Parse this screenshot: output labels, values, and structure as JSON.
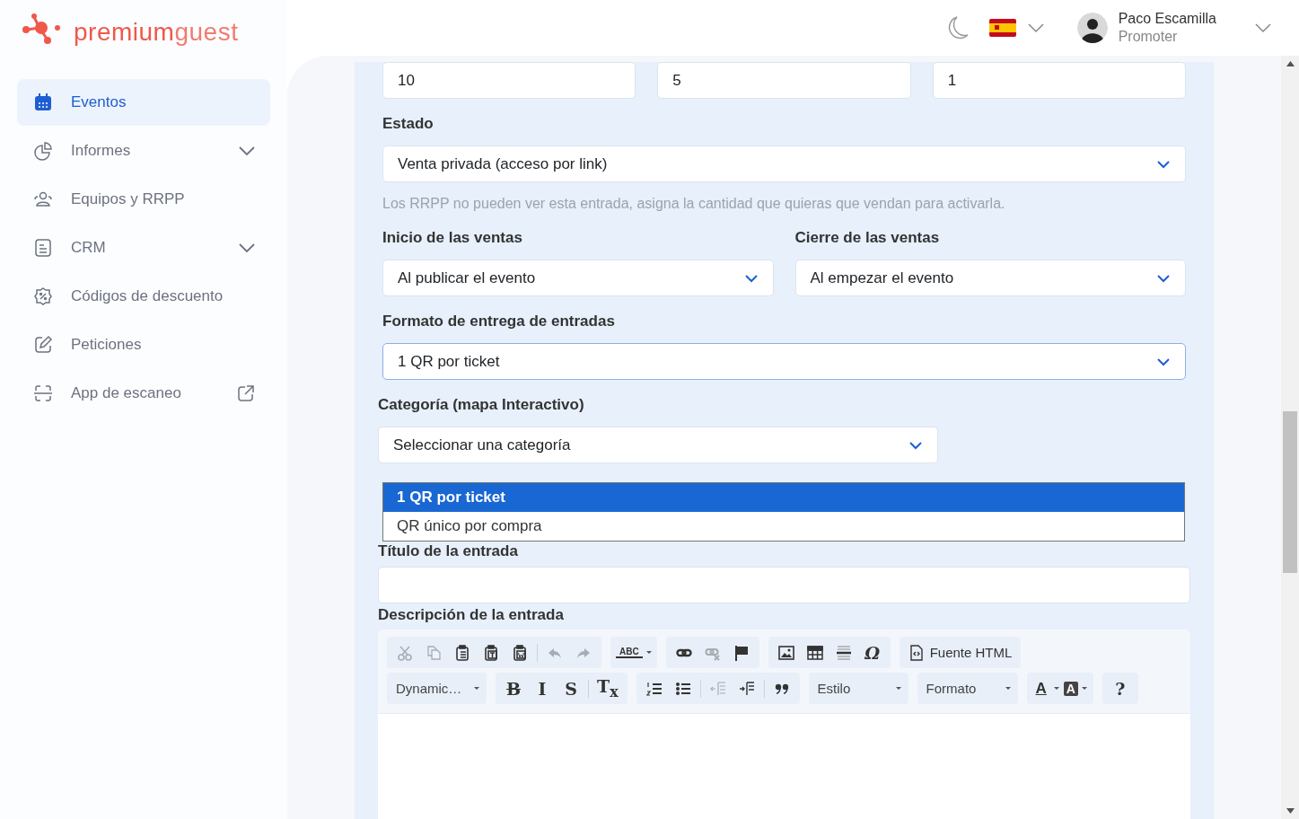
{
  "logo": {
    "text_main": "premium",
    "text_accent": "guest"
  },
  "sidebar": {
    "items": [
      {
        "label": "Eventos",
        "selected": true,
        "has_submenu": false,
        "external": false
      },
      {
        "label": "Informes",
        "selected": false,
        "has_submenu": true,
        "external": false
      },
      {
        "label": "Equipos y RRPP",
        "selected": false,
        "has_submenu": false,
        "external": false
      },
      {
        "label": "CRM",
        "selected": false,
        "has_submenu": true,
        "external": false
      },
      {
        "label": "Códigos de descuento",
        "selected": false,
        "has_submenu": false,
        "external": false
      },
      {
        "label": "Peticiones",
        "selected": false,
        "has_submenu": false,
        "external": false
      },
      {
        "label": "App de escaneo",
        "selected": false,
        "has_submenu": false,
        "external": true
      }
    ]
  },
  "header": {
    "user": {
      "name": "Paco Escamilla",
      "role": "Promoter"
    }
  },
  "form": {
    "top_inputs": [
      {
        "value": "10"
      },
      {
        "value": "5"
      },
      {
        "value": "1"
      }
    ],
    "status": {
      "label": "Estado",
      "value": "Venta privada (acceso por link)",
      "hint": "Los RRPP no pueden ver esta entrada, asigna la cantidad que quieras que vendan para activarla."
    },
    "sales": [
      {
        "label": "Inicio de las ventas",
        "value": "Al publicar el evento"
      },
      {
        "label": "Cierre de las ventas",
        "value": "Al empezar el evento"
      }
    ],
    "delivery": {
      "label": "Formato de entrega de entradas",
      "value": "1 QR por ticket",
      "expanded": true,
      "options": [
        {
          "label": "1 QR por ticket",
          "selected": true
        },
        {
          "label": "QR único por compra",
          "selected": false
        }
      ]
    },
    "category": {
      "label": "Categoría (mapa Interactivo)",
      "value": "Seleccionar una categoría"
    },
    "title": {
      "label": "Título de la entrada"
    },
    "description": {
      "label": "Descripción de la entrada",
      "toolbar": [
        [
          [
            {
              "kind": "icon",
              "disabled": true
            },
            {
              "kind": "icon",
              "disabled": true
            },
            {
              "kind": "icon",
              "disabled": false
            },
            {
              "kind": "icon",
              "disabled": false
            },
            {
              "kind": "icon",
              "disabled": false
            },
            {
              "kind": "separator"
            },
            {
              "kind": "icon",
              "disabled": true
            },
            {
              "kind": "icon",
              "disabled": true
            }
          ],
          [
            {
              "kind": "glyph",
              "label": "ABC",
              "caret": true
            }
          ],
          [
            {
              "kind": "icon",
              "disabled": false
            },
            {
              "kind": "icon",
              "disabled": true
            },
            {
              "kind": "icon",
              "disabled": false
            }
          ],
          [
            {
              "kind": "icon",
              "disabled": false
            },
            {
              "kind": "icon",
              "disabled": false
            },
            {
              "kind": "icon",
              "disabled": false
            },
            {
              "kind": "glyph",
              "label": "Ω",
              "caret": false
            }
          ],
          [
            {
              "kind": "text",
              "label": "Fuente HTML"
            }
          ]
        ],
        [
          [
            {
              "kind": "combo",
              "label": "Dynamic…"
            }
          ],
          [
            {
              "kind": "glyph",
              "label": "B",
              "caret": false
            },
            {
              "kind": "glyph",
              "label": "I",
              "caret": false
            },
            {
              "kind": "glyph",
              "label": "S",
              "caret": false
            },
            {
              "kind": "separator"
            },
            {
              "kind": "glyph",
              "label": "T$_{x}$",
              "caret": false
            }
          ],
          [
            {
              "kind": "icon",
              "disabled": false
            },
            {
              "kind": "icon",
              "disabled": false
            },
            {
              "kind": "separator"
            },
            {
              "kind": "icon",
              "disabled": true
            },
            {
              "kind": "icon",
              "disabled": false
            },
            {
              "kind": "separator"
            },
            {
              "kind": "icon",
              "disabled": false
            }
          ],
          [
            {
              "kind": "combo",
              "label": "Estilo"
            }
          ],
          [
            {
              "kind": "combo",
              "label": "Formato"
            }
          ],
          [
            {
              "kind": "glyph",
              "label": "A",
              "caret": true
            },
            {
              "kind": "glyph",
              "label": "A",
              "caret": true
            }
          ],
          [
            {
              "kind": "glyph",
              "label": "?",
              "caret": false
            }
          ]
        ]
      ]
    }
  }
}
